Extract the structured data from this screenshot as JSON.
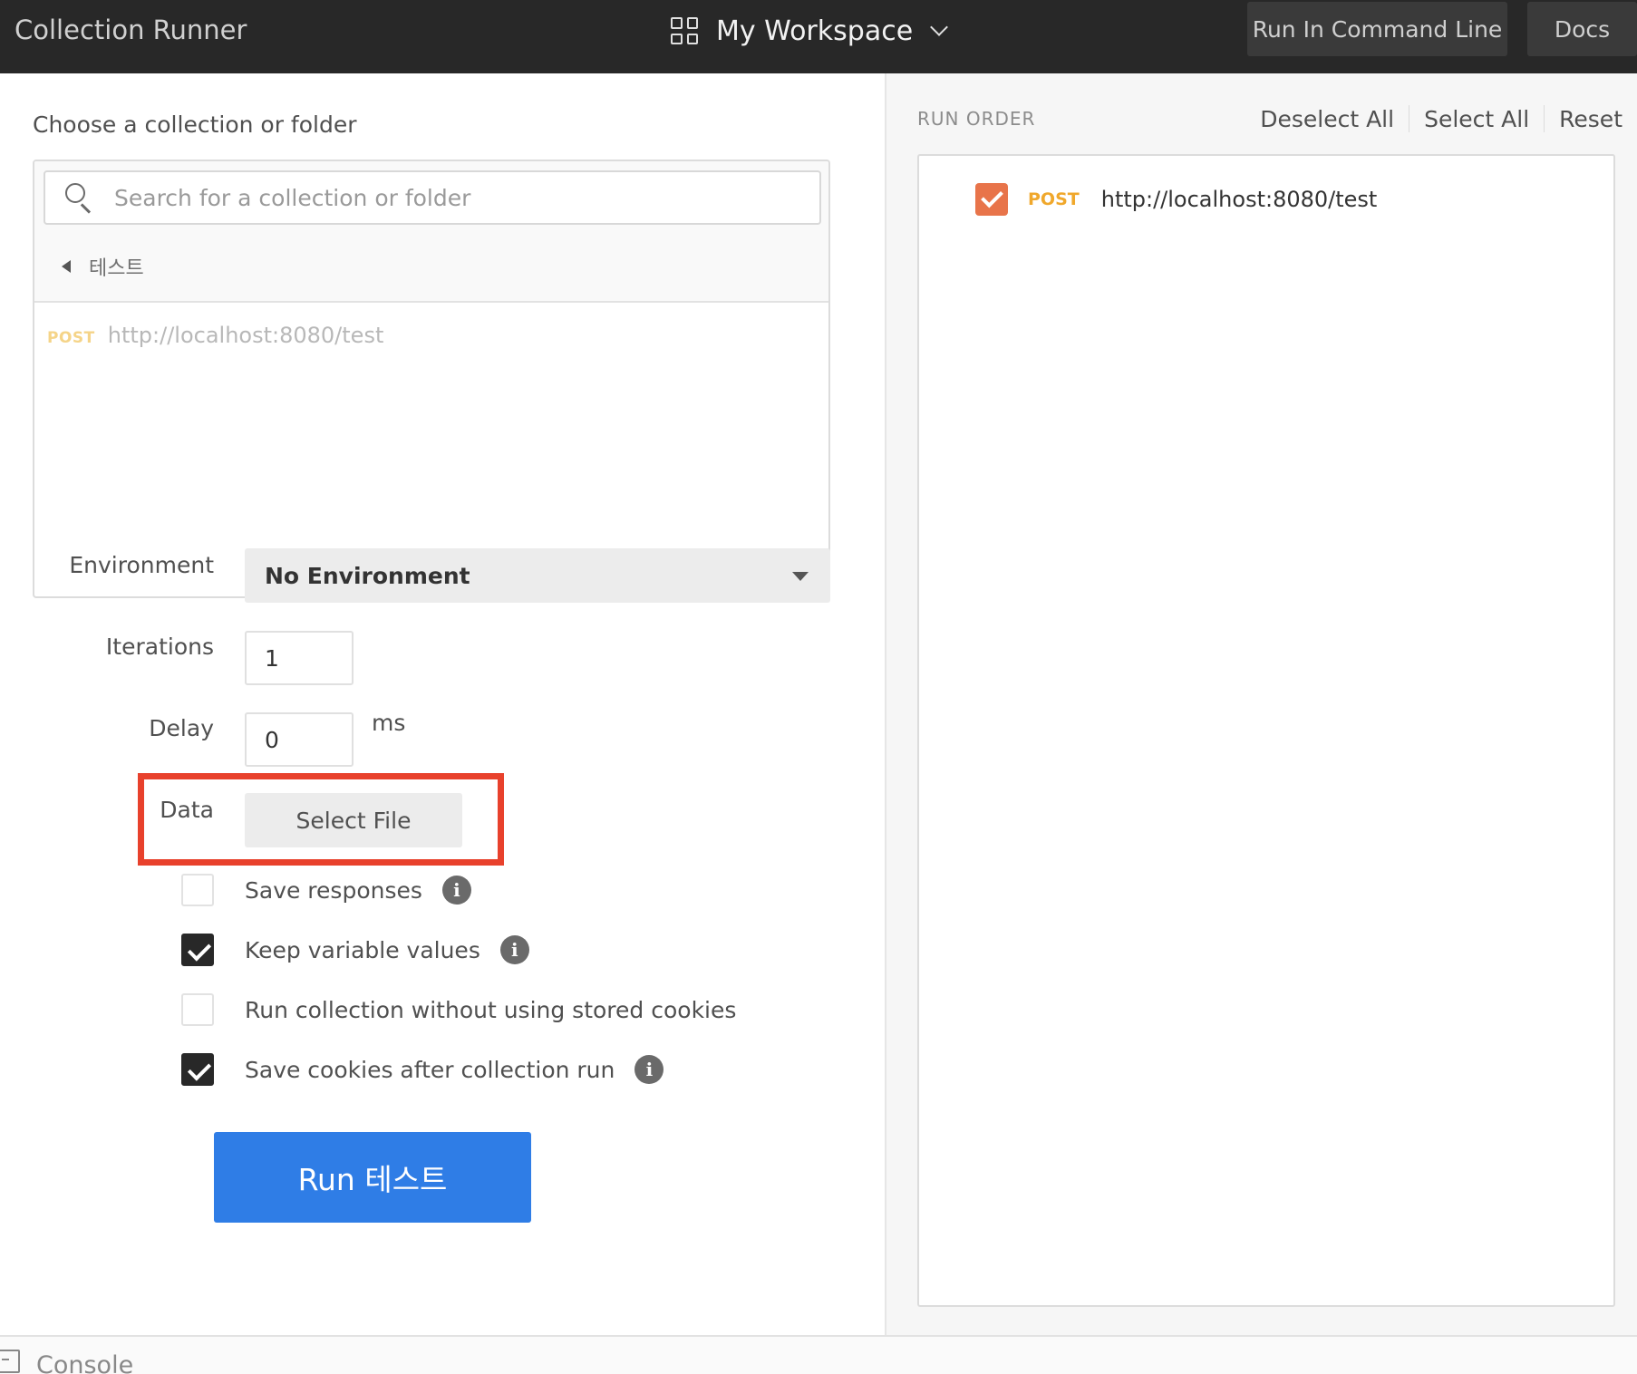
{
  "header": {
    "title": "Collection Runner",
    "workspace": "My Workspace",
    "run_cli": "Run In Command Line",
    "docs": "Docs"
  },
  "left": {
    "choose_label": "Choose a collection or folder",
    "search_placeholder": "Search for a collection or folder",
    "breadcrumb": "테스트",
    "request": {
      "method": "POST",
      "url": "http://localhost:8080/test"
    }
  },
  "form": {
    "environment_label": "Environment",
    "environment_value": "No Environment",
    "iterations_label": "Iterations",
    "iterations_value": "1",
    "delay_label": "Delay",
    "delay_value": "0",
    "delay_unit": "ms",
    "data_label": "Data",
    "select_file": "Select File",
    "highlight_color": "#e8412c"
  },
  "options": [
    {
      "label": "Save responses",
      "checked": false,
      "info": true
    },
    {
      "label": "Keep variable values",
      "checked": true,
      "info": true
    },
    {
      "label": "Run collection without using stored cookies",
      "checked": false,
      "info": false
    },
    {
      "label": "Save cookies after collection run",
      "checked": true,
      "info": true
    }
  ],
  "run_button": "Run 테스트",
  "run_button_color": "#2f7de6",
  "right": {
    "run_order_label": "RUN ORDER",
    "deselect_all": "Deselect All",
    "select_all": "Select All",
    "reset": "Reset",
    "items": [
      {
        "method": "POST",
        "url": "http://localhost:8080/test",
        "checked": true
      }
    ],
    "check_color": "#e8744a"
  },
  "footer": {
    "console": "Console"
  },
  "icons": {
    "workspace": "grid-icon",
    "chevron": "chevron-down-icon",
    "search": "search-icon",
    "back": "caret-left-icon",
    "caret": "caret-down-icon",
    "info": "info-icon",
    "console": "console-icon"
  }
}
